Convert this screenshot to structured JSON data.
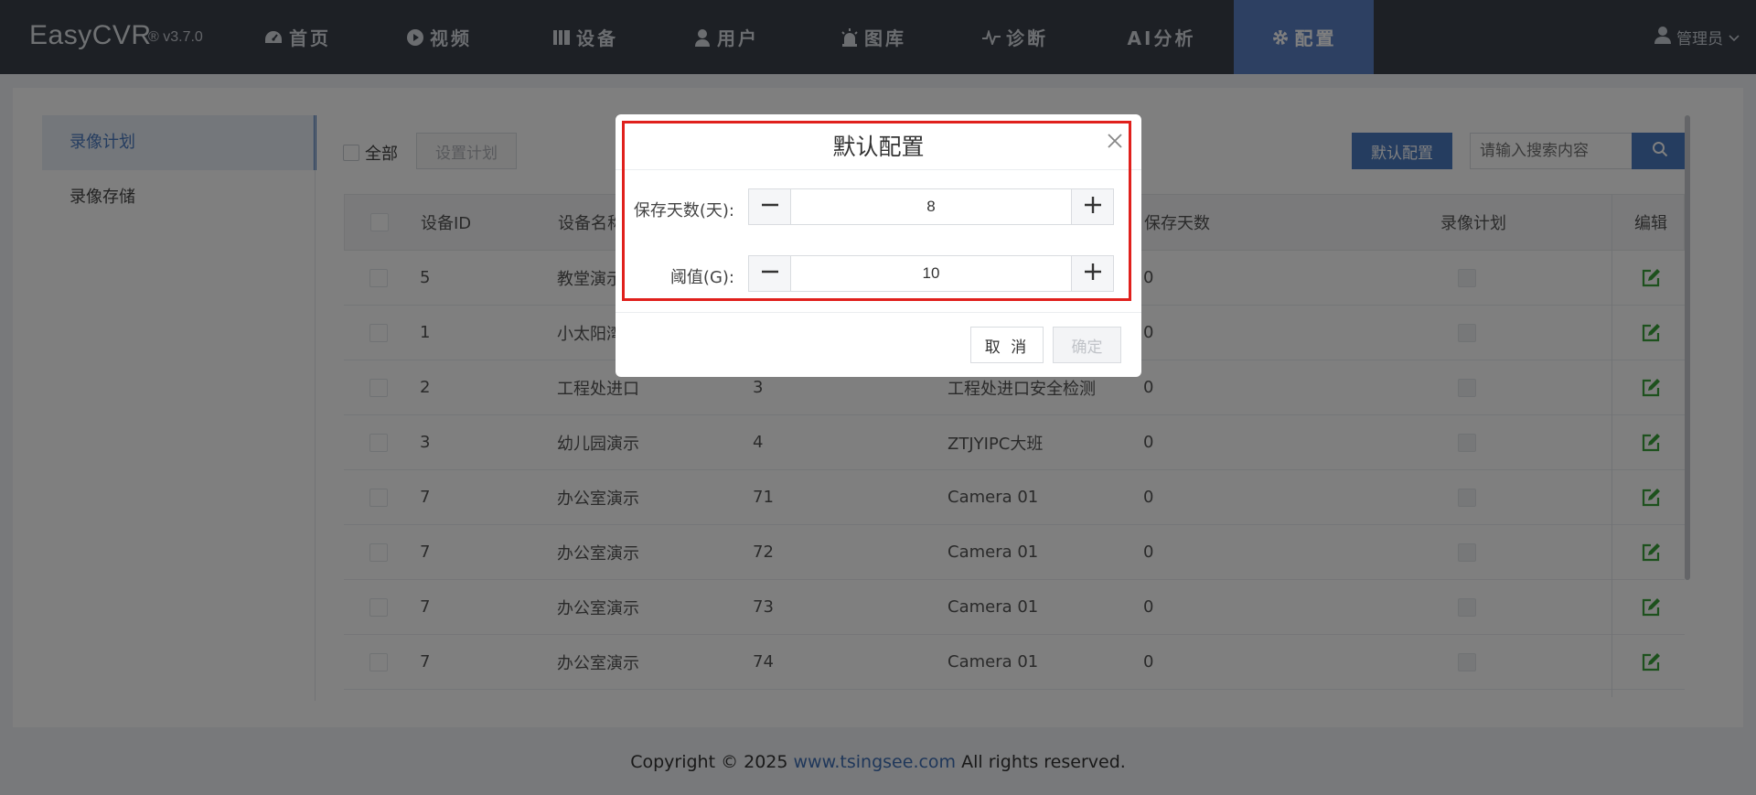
{
  "app": {
    "name": "EasyCVR",
    "version": "® v3.7.0"
  },
  "nav": [
    {
      "label": "首页",
      "icon": "dashboard-icon"
    },
    {
      "label": "视频",
      "icon": "play-icon"
    },
    {
      "label": "设备",
      "icon": "device-icon"
    },
    {
      "label": "用户",
      "icon": "user-icon"
    },
    {
      "label": "图库",
      "icon": "alarm-icon"
    },
    {
      "label": "诊断",
      "icon": "pulse-icon"
    },
    {
      "label": "AI分析",
      "icon": ""
    },
    {
      "label": "配置",
      "icon": "gear-icon",
      "active": true
    }
  ],
  "user": {
    "name": "管理员"
  },
  "sidebar": {
    "items": [
      {
        "label": "录像计划",
        "active": true
      },
      {
        "label": "录像存储"
      }
    ]
  },
  "toolbar": {
    "select_all": "全部",
    "set_plan": "设置计划",
    "default_config": "默认配置",
    "search_placeholder": "请输入搜索内容"
  },
  "table": {
    "headers": {
      "device_id": "设备ID",
      "device_name": "设备名称",
      "save_days": "保存天数",
      "plan": "录像计划",
      "edit": "编辑"
    },
    "rows": [
      {
        "device_id": "5",
        "device_name": "教堂演示",
        "channel": "",
        "channel_name": "",
        "save_days": "0"
      },
      {
        "device_id": "1",
        "device_name": "小太阳湾",
        "channel": "",
        "channel_name": "",
        "save_days": "0"
      },
      {
        "device_id": "2",
        "device_name": "工程处进口",
        "channel": "3",
        "channel_name": "工程处进口安全检测",
        "save_days": "0"
      },
      {
        "device_id": "3",
        "device_name": "幼儿园演示",
        "channel": "4",
        "channel_name": "ZTJYIPC大班",
        "save_days": "0"
      },
      {
        "device_id": "7",
        "device_name": "办公室演示",
        "channel": "71",
        "channel_name": "Camera 01",
        "save_days": "0"
      },
      {
        "device_id": "7",
        "device_name": "办公室演示",
        "channel": "72",
        "channel_name": "Camera 01",
        "save_days": "0"
      },
      {
        "device_id": "7",
        "device_name": "办公室演示",
        "channel": "73",
        "channel_name": "Camera 01",
        "save_days": "0"
      },
      {
        "device_id": "7",
        "device_name": "办公室演示",
        "channel": "74",
        "channel_name": "Camera 01",
        "save_days": "0"
      }
    ]
  },
  "footer": {
    "prefix": "Copyright © 2025 ",
    "link": "www.tsingsee.com",
    "suffix": " All rights reserved."
  },
  "modal": {
    "title": "默认配置",
    "fields": [
      {
        "label": "保存天数(天):",
        "value": "8"
      },
      {
        "label": "阈值(G):",
        "value": "10"
      }
    ],
    "cancel": "取 消",
    "confirm": "确定"
  },
  "colors": {
    "nav_bg": "#3a404b",
    "accent": "#4a7ac0",
    "nav_active": "#5a80c4",
    "edit_icon": "#3aa23a",
    "highlight": "#e0201c"
  }
}
